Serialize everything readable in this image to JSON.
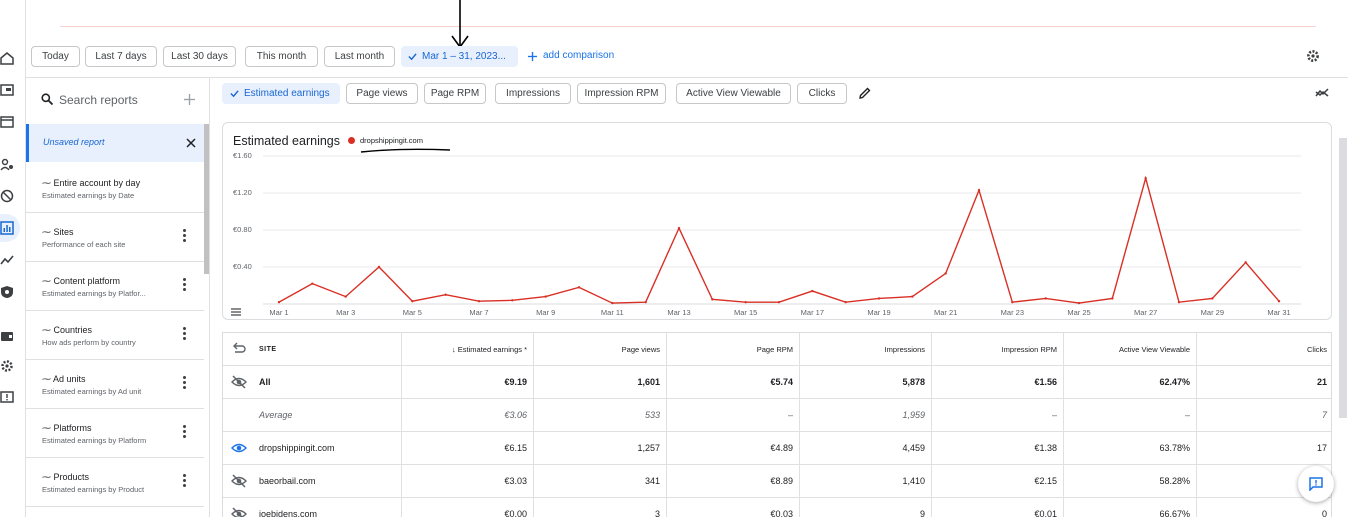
{
  "rail": {
    "icons": [
      "home-icon",
      "ad-units-icon",
      "sites-icon",
      "people-icon",
      "block-icon",
      "reports-icon",
      "trend-icon",
      "policy-icon",
      "payments-icon",
      "settings-icon",
      "feedback-icon"
    ]
  },
  "toolbar": {
    "chips": [
      "Today",
      "Last 7 days",
      "Last 30 days",
      "This month",
      "Last month",
      "Mar 1 – 31, 2023..."
    ],
    "selected_chip": "Mar 1 – 31, 2023...",
    "add_comparison": "add comparison"
  },
  "sidebar": {
    "search_placeholder": "Search reports",
    "unsaved": "Unsaved report",
    "items": [
      {
        "title": "Entire account by day",
        "subtitle": "Estimated earnings by Date"
      },
      {
        "title": "Sites",
        "subtitle": "Performance of each site"
      },
      {
        "title": "Content platform",
        "subtitle": "Estimated earnings by Platfor..."
      },
      {
        "title": "Countries",
        "subtitle": "How ads perform by country"
      },
      {
        "title": "Ad units",
        "subtitle": "Estimated earnings by Ad unit"
      },
      {
        "title": "Platforms",
        "subtitle": "Estimated earnings by Platform"
      },
      {
        "title": "Products",
        "subtitle": "Estimated earnings by Product"
      }
    ]
  },
  "metrics": {
    "chips": [
      "Estimated earnings",
      "Page views",
      "Page RPM",
      "Impressions",
      "Impression RPM",
      "Active View Viewable",
      "Clicks"
    ],
    "selected": "Estimated earnings"
  },
  "chart_data": {
    "type": "line",
    "title": "Estimated earnings",
    "series": [
      {
        "name": "dropshippingit.com",
        "color": "#d93025",
        "values": [
          0.02,
          0.22,
          0.08,
          0.4,
          0.03,
          0.1,
          0.03,
          0.04,
          0.08,
          0.18,
          0.01,
          0.02,
          0.82,
          0.05,
          0.02,
          0.02,
          0.14,
          0.02,
          0.06,
          0.08,
          0.33,
          1.23,
          0.02,
          0.06,
          0.01,
          0.06,
          1.36,
          0.02,
          0.06,
          0.45,
          0.03
        ]
      }
    ],
    "x": [
      "Mar 1",
      "Mar 2",
      "Mar 3",
      "Mar 4",
      "Mar 5",
      "Mar 6",
      "Mar 7",
      "Mar 8",
      "Mar 9",
      "Mar 10",
      "Mar 11",
      "Mar 12",
      "Mar 13",
      "Mar 14",
      "Mar 15",
      "Mar 16",
      "Mar 17",
      "Mar 18",
      "Mar 19",
      "Mar 20",
      "Mar 21",
      "Mar 22",
      "Mar 23",
      "Mar 24",
      "Mar 25",
      "Mar 26",
      "Mar 27",
      "Mar 28",
      "Mar 29",
      "Mar 30",
      "Mar 31"
    ],
    "x_tick_labels": [
      "Mar 1",
      "Mar 3",
      "Mar 5",
      "Mar 7",
      "Mar 9",
      "Mar 11",
      "Mar 13",
      "Mar 15",
      "Mar 17",
      "Mar 19",
      "Mar 21",
      "Mar 23",
      "Mar 25",
      "Mar 27",
      "Mar 29",
      "Mar 31"
    ],
    "y_tick_labels": [
      "€1.60",
      "€1.20",
      "€0.80",
      "€0.40"
    ],
    "ylim": [
      0,
      1.6
    ],
    "grid": true
  },
  "table": {
    "headers": [
      "SITE",
      "↓ Estimated earnings *",
      "Page views",
      "Page RPM",
      "Impressions",
      "Impression RPM",
      "Active View Viewable",
      "Clicks"
    ],
    "rows": [
      {
        "kind": "all",
        "icon": "visibility-off-icon",
        "cells": [
          "All",
          "€9.19",
          "1,601",
          "€5.74",
          "5,878",
          "€1.56",
          "62.47%",
          "21"
        ]
      },
      {
        "kind": "avg",
        "icon": "",
        "cells": [
          "Average",
          "€3.06",
          "533",
          "–",
          "1,959",
          "–",
          "–",
          "7"
        ]
      },
      {
        "kind": "site",
        "icon": "visibility-icon",
        "cells": [
          "dropshippingit.com",
          "€6.15",
          "1,257",
          "€4.89",
          "4,459",
          "€1.38",
          "63.78%",
          "17"
        ]
      },
      {
        "kind": "site",
        "icon": "visibility-off-icon",
        "cells": [
          "baeorbail.com",
          "€3.03",
          "341",
          "€8.89",
          "1,410",
          "€2.15",
          "58.28%",
          ""
        ]
      },
      {
        "kind": "site",
        "icon": "visibility-off-icon",
        "cells": [
          "joebidens.com",
          "€0.00",
          "3",
          "€0.03",
          "9",
          "€0.01",
          "66.67%",
          "0"
        ]
      }
    ]
  }
}
